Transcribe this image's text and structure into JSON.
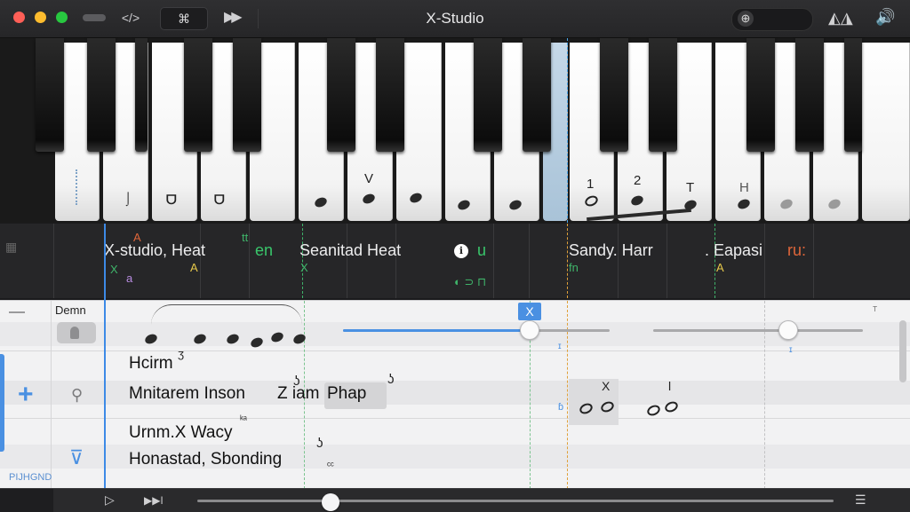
{
  "window": {
    "title": "X-Studio",
    "toolbar": {
      "code_icon": "</>",
      "loop_icon": "⌘",
      "forward_icon": "▶▶",
      "search_icon": "⊕",
      "split_icon": "◭◮",
      "speaker_icon": "🔊"
    }
  },
  "piano": {
    "key_marks": {
      "m1": "⌡",
      "m2": "ᗜ",
      "m3": "ᗜ",
      "m4": "V",
      "m5": "1",
      "m6": "2",
      "m7": "T",
      "m8": "H"
    }
  },
  "lane": {
    "clips": [
      {
        "label": "X-studio, Heat",
        "tag": "A",
        "sub": "X"
      },
      {
        "label": "Seanitad Heat",
        "tag": "X"
      },
      {
        "label": "Sandy. Harr",
        "tag": "fn"
      },
      {
        "label": ". Eapasi",
        "tag": "A"
      }
    ],
    "accent_en": "en",
    "accent_ru": "ru:",
    "accent_tt": "tt",
    "accent_u": "u",
    "accent_a": "a",
    "accent_sub": "◐ ⊃ ⊓",
    "accent_info": "ℹ",
    "accent_a2": "A"
  },
  "editor": {
    "header_label": "Demn",
    "badge": "X",
    "rows": [
      {
        "label": "Hcirm",
        "mark": "ʒ"
      },
      {
        "label": "Mnitarem Inson",
        "extra": "Z iam",
        "chip": "Phap",
        "mark1": "ʖ",
        "mark2": "ʖ"
      },
      {
        "label": "Urnm.X Wacy",
        "mark": "ᵏᵃ"
      },
      {
        "label": "Honastad, Sbonding",
        "mark": "ʖ",
        "mark2": "ᶜᶜ"
      }
    ],
    "right_marks": {
      "x": "X",
      "l": "l",
      "b": "ɓ",
      "t1": "ɪ",
      "t2": "ɪ"
    },
    "footer": "PIJHGND",
    "corner": "ᵀ"
  },
  "transport": {
    "play_icon": "▷",
    "skip_icon": "▶▶ǀ",
    "list_icon": "☰",
    "position_fraction": 0.21
  },
  "colors": {
    "accent": "#4a90e2",
    "green": "#39c66b",
    "orange": "#e0663a"
  }
}
